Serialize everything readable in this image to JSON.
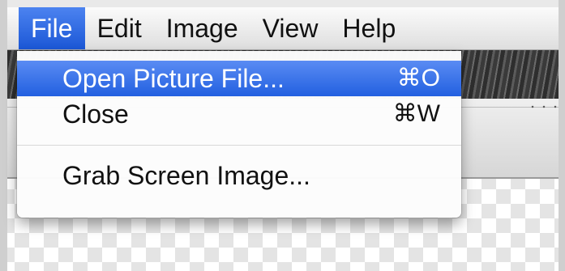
{
  "menubar": {
    "items": [
      {
        "label": "File"
      },
      {
        "label": "Edit"
      },
      {
        "label": "Image"
      },
      {
        "label": "View"
      },
      {
        "label": "Help"
      }
    ],
    "active": "File"
  },
  "file_menu": {
    "open": {
      "label": "Open Picture File...",
      "shortcut": "⌘O"
    },
    "close": {
      "label": "Close",
      "shortcut": "⌘W"
    },
    "grab": {
      "label": "Grab Screen Image..."
    }
  },
  "colors": {
    "highlight": "#2260e0",
    "menu_text": "#111111",
    "highlight_text": "#ffffff"
  }
}
